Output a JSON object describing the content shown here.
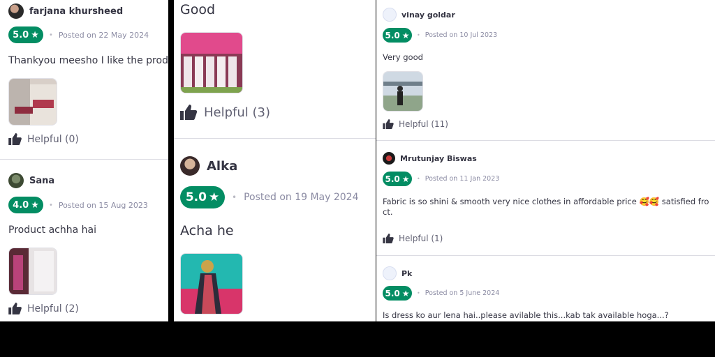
{
  "panel1": {
    "reviews": [
      {
        "user": "farjana khursheed",
        "rating": "5.0",
        "posted": "Posted on 22 May 2024",
        "text": "Thankyou meesho I like the product",
        "helpful": "Helpful (0)"
      },
      {
        "user": "Sana",
        "rating": "4.0",
        "posted": "Posted on 15 Aug 2023",
        "text": "Product achha hai",
        "helpful": "Helpful (2)"
      }
    ]
  },
  "panel2": {
    "reviews": [
      {
        "text": "Good",
        "helpful": "Helpful (3)"
      },
      {
        "user": "Alka",
        "rating": "5.0",
        "posted": "Posted on 19 May 2024",
        "text": "Acha he"
      }
    ]
  },
  "panel3": {
    "reviews": [
      {
        "user": "vinay goldar",
        "rating": "5.0",
        "posted": "Posted on 10 Jul 2023",
        "text": "Very good",
        "helpful": "Helpful (11)"
      },
      {
        "user": "Mrutunjay Biswas",
        "rating": "5.0",
        "posted": "Posted on 11 Jan 2023",
        "text_line1": "Fabric is so shini & smooth very nice clothes in affordable price 🥰🥰 satisfied fro",
        "text_line2": "ct.",
        "helpful": "Helpful (1)"
      },
      {
        "user": "Pk",
        "rating": "5.0",
        "posted": "Posted on 5 June 2024",
        "text": "Is dress ko aur lena hai..please avilable this...kab tak available hoga...?"
      }
    ]
  },
  "icons": {
    "star": "star-icon",
    "like": "thumbs-up-icon",
    "avatar_default": "user-placeholder-icon"
  },
  "colors": {
    "badge_green": "#038d63",
    "text": "#353543",
    "muted": "#8b8ba3"
  }
}
